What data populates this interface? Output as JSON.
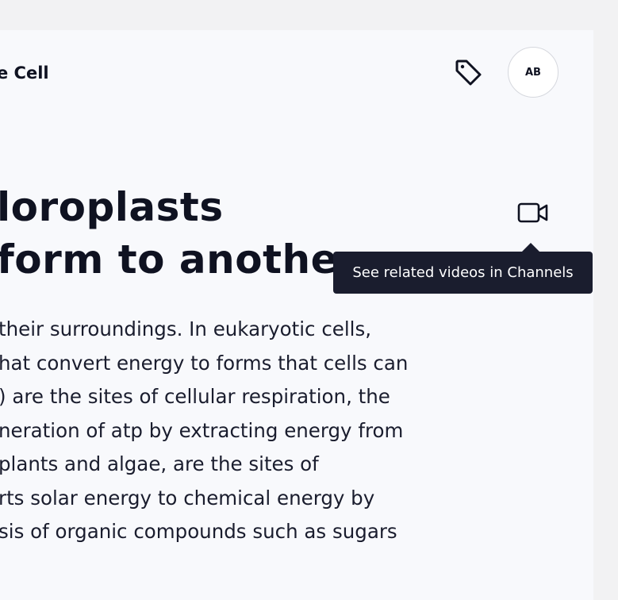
{
  "header": {
    "title": "e Cell",
    "avatar_initials": "AB",
    "tag_icon": "tag-icon"
  },
  "article": {
    "heading_lines": [
      "loroplasts",
      "form to anothe"
    ],
    "video_icon": "video-camera-icon",
    "tooltip": "See related videos in Channels",
    "body_lines": [
      "their surroundings. In eukaryotic cells,",
      "hat convert energy to forms that cells can",
      ") are the sites of cellular respiration, the",
      "neration of atp by extracting energy from",
      "plants and algae, are the sites of",
      "rts solar energy to chemical energy by",
      "sis of organic compounds such as sugars"
    ]
  },
  "colors": {
    "text": "#0f1221",
    "tooltip_bg": "#1a1d2e",
    "card_bg": "#f8f9fc",
    "page_bg": "#f2f2f3"
  }
}
